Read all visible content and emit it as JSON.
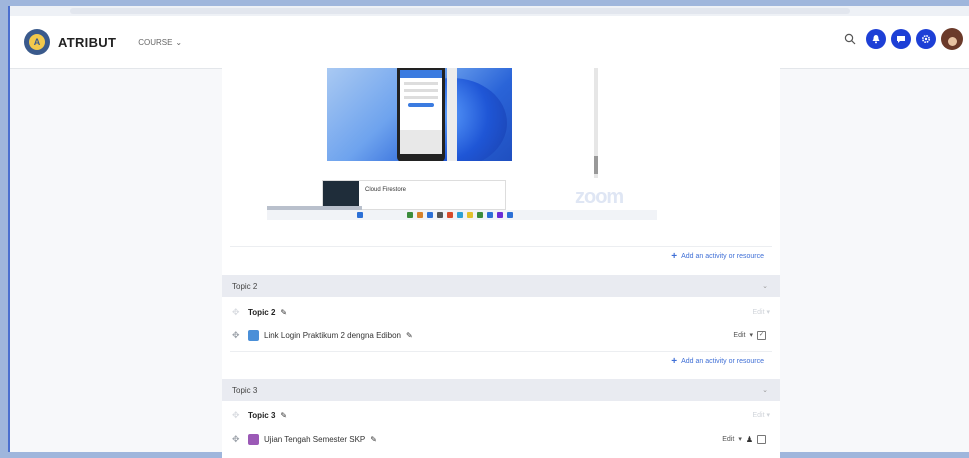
{
  "navbar": {
    "brand": "ATRIBUT",
    "course_menu": "COURSE",
    "brand_color": "#1d3fd6"
  },
  "screenshot": {
    "firebase_title": "Cloud Firestore",
    "zoom_watermark": "zoom"
  },
  "sections": [
    {
      "add_resource": "Add an activity or resource"
    },
    {
      "header": "Topic 2",
      "summary_title": "Topic 2",
      "summary_edit": "Edit",
      "activity_name": "Link Login Praktikum 2 dengna Edibon",
      "activity_edit": "Edit",
      "add_resource": "Add an activity or resource"
    },
    {
      "header": "Topic 3",
      "summary_title": "Topic 3",
      "summary_edit": "Edit",
      "activity_name": "Ujian Tengah Semester SKP",
      "activity_edit": "Edit"
    }
  ]
}
